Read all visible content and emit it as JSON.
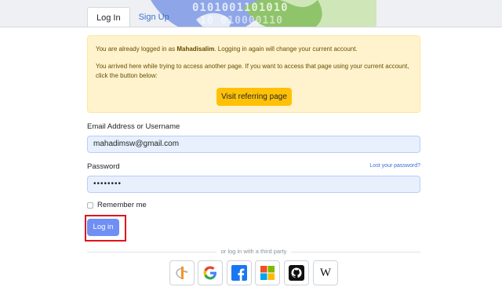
{
  "tabs": [
    {
      "label": "Log In",
      "active": true
    },
    {
      "label": "Sign Up",
      "active": false
    }
  ],
  "banner": {
    "bits_line1": "0101001101010",
    "bits_line2": "10    010000110"
  },
  "alert": {
    "line1_prefix": "You are already logged in as ",
    "username": "Mahadisalim",
    "line1_suffix": ". Logging in again will change your current account.",
    "line2": "You arrived here while trying to access another page. If you want to access that page using your current account, click the button below:",
    "button_label": "Visit referring page"
  },
  "form": {
    "email_label": "Email Address or Username",
    "email_value": "mahadimsw@gmail.com",
    "password_label": "Password",
    "password_value": "••••••••",
    "lost_password": "Lost your password?",
    "remember_label": "Remember me",
    "remember_checked": false,
    "login_button": "Log in"
  },
  "third_party": {
    "divider_text": "or log in with a third party",
    "providers": [
      "openid-icon",
      "google-icon",
      "facebook-icon",
      "microsoft-icon",
      "github-icon",
      "wikipedia-icon"
    ],
    "wikipedia_glyph": "W"
  },
  "colors": {
    "primary": "#6f8ff5",
    "alert_bg": "#fff3cd",
    "alert_button": "#ffc107",
    "highlight": "#e0141e",
    "link": "#3b6fd4"
  }
}
